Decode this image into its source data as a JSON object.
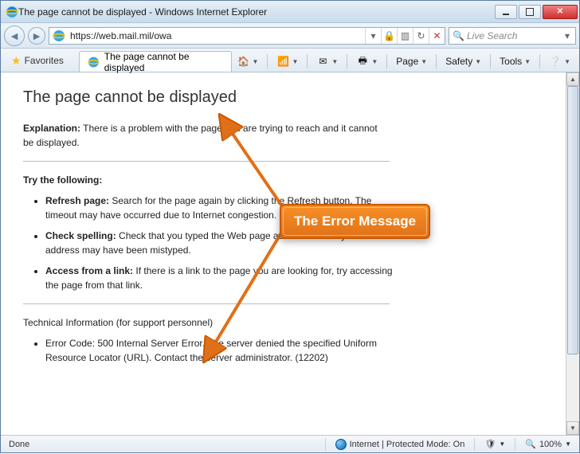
{
  "window": {
    "title": "The page cannot be displayed - Windows Internet Explorer"
  },
  "nav": {
    "url": "https://web.mail.mil/owa",
    "search_placeholder": "Live Search"
  },
  "tabs": {
    "favorites_label": "Favorites",
    "active_tab_title": "The page cannot be displayed"
  },
  "cmd": {
    "page": "Page",
    "safety": "Safety",
    "tools": "Tools"
  },
  "error": {
    "heading": "The page cannot be displayed",
    "explanation_label": "Explanation:",
    "explanation_text": "There is a problem with the page you are trying to reach and it cannot be displayed.",
    "try_label": "Try the following:",
    "bullets": [
      {
        "b": "Refresh page:",
        "t": "Search for the page again by clicking the Refresh button. The timeout may have occurred due to Internet congestion."
      },
      {
        "b": "Check spelling:",
        "t": "Check that you typed the Web page address correctly. The address may have been mistyped."
      },
      {
        "b": "Access from a link:",
        "t": "If there is a link to the page you are looking for, try accessing the page from that link."
      }
    ],
    "tech_label": "Technical Information (for support personnel)",
    "tech_bullet": "Error Code: 500 Internal Server Error. The server denied the specified Uniform Resource Locator (URL). Contact the server administrator. (12202)"
  },
  "status": {
    "done": "Done",
    "zone": "Internet | Protected Mode: On",
    "zoom": "100%"
  },
  "annotation": {
    "label": "The Error Message"
  }
}
